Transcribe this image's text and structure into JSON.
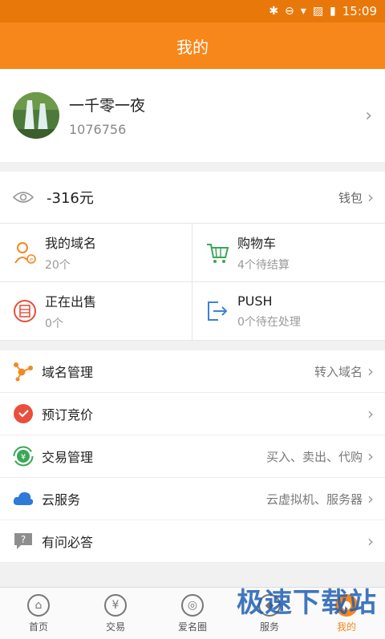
{
  "status": {
    "time": "15:09"
  },
  "header": {
    "title": "我的"
  },
  "profile": {
    "name": "一千零一夜",
    "id": "1076756"
  },
  "wallet": {
    "balance": "-316元",
    "link_label": "钱包"
  },
  "quick": [
    {
      "title": "我的域名",
      "sub": "20个",
      "icon": "user-domain-icon"
    },
    {
      "title": "购物车",
      "sub": "4个待结算",
      "icon": "cart-icon"
    },
    {
      "title": "正在出售",
      "sub": "0个",
      "icon": "sell-tag-icon"
    },
    {
      "title": "PUSH",
      "sub": "0个待在处理",
      "icon": "push-icon"
    }
  ],
  "menu": [
    {
      "label": "域名管理",
      "right": "转入域名",
      "icon": "domain-manage-icon"
    },
    {
      "label": "预订竞价",
      "right": "",
      "icon": "clock-icon"
    },
    {
      "label": "交易管理",
      "right": "买入、卖出、代购",
      "icon": "trade-icon"
    },
    {
      "label": "云服务",
      "right": "云虚拟机、服务器",
      "icon": "cloud-icon"
    },
    {
      "label": "有问必答",
      "right": "",
      "icon": "question-icon"
    }
  ],
  "tabs": [
    {
      "label": "首页",
      "icon": "home-icon",
      "glyph": "⌂"
    },
    {
      "label": "交易",
      "icon": "yen-icon",
      "glyph": "¥"
    },
    {
      "label": "爱名圈",
      "icon": "circle-icon",
      "glyph": "◎"
    },
    {
      "label": "服务",
      "icon": "service-icon",
      "glyph": "◆"
    },
    {
      "label": "我的",
      "icon": "profile-icon",
      "glyph": "●"
    }
  ],
  "watermark": "极速下载站",
  "colors": {
    "brand": "#f7871b",
    "statusbar": "#e9780b"
  }
}
